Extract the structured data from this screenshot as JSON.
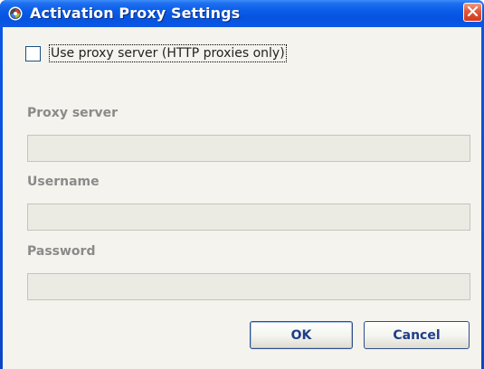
{
  "window": {
    "title": "Activation Proxy Settings",
    "title_icon": "app-swirl-icon",
    "close_icon": "close-icon"
  },
  "proxy": {
    "use_proxy_label": "Use proxy server (HTTP proxies only)",
    "use_proxy_checked": false
  },
  "fields": {
    "server_label": "Proxy server",
    "server_value": "",
    "username_label": "Username",
    "username_value": "",
    "password_label": "Password",
    "password_value": ""
  },
  "buttons": {
    "ok_label": "OK",
    "cancel_label": "Cancel"
  },
  "colors": {
    "titlebar": "#0a58e6",
    "close_button": "#e2573a",
    "disabled_label": "#8a8a8a",
    "button_text": "#1d3f86"
  }
}
